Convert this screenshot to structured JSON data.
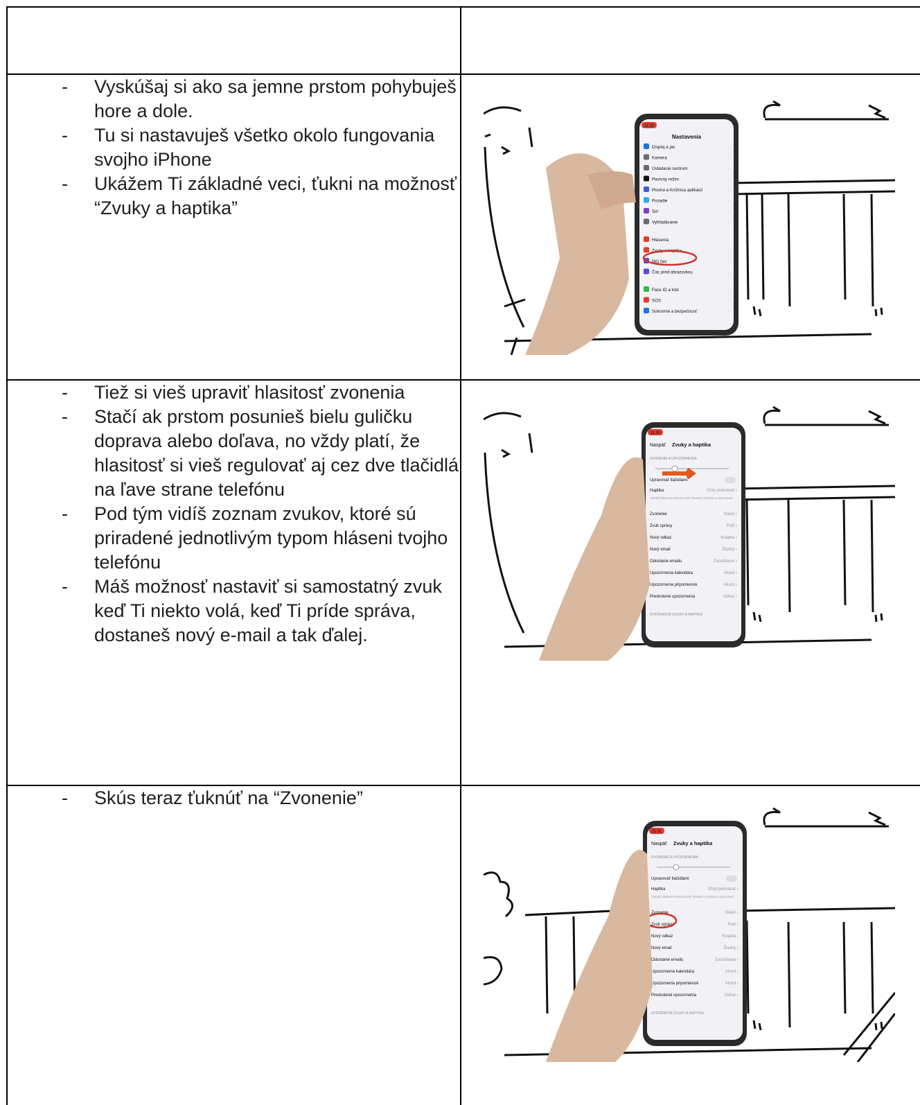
{
  "rows": [
    {
      "bullets": [
        "Vyskúšaj si ako sa jemne prstom pohybuješ hore a dole.",
        "Tu si nastavuješ všetko okolo fungovania svojho iPhone",
        "Ukážem Ti základné veci, ťukni na možnosť “Zvuky a haptika”"
      ],
      "phone": {
        "time": "11:30",
        "title": "Nastavenia",
        "items": [
          "Displej a jas",
          "Kamera",
          "Ovládacie centrum",
          "Pasívny režim",
          "Plocha a Knižnica aplikácií",
          "Pozadie",
          "Siri",
          "Vyhľadávanie",
          "Hlásenia",
          "Zvuky a haptika",
          "Môj čas",
          "Čas pred obrazovkou",
          "Face ID a kód",
          "SOS",
          "Súkromie a bezpečnosť"
        ]
      }
    },
    {
      "bullets": [
        "Tiež si vieš upraviť hlasitosť zvonenia",
        "Stačí ak prstom posunieš bielu guličku doprava alebo doľava, no vždy platí, že hlasitosť si vieš regulovať aj cez dve tlačidlá na ľave strane telefónu",
        "Pod tým vidíš zoznam zvukov, ktoré sú priradené jednotlivým typom hláseni tvojho telefónu",
        "Máš možnosť nastaviť si samostatný zvuk keď Ti niekto volá, keď Ti príde správa, dostaneš nový e-mail a tak ďalej."
      ],
      "phone": {
        "time": "11:30",
        "back": "Naspäť",
        "title": "Zvuky a haptika",
        "section": "ZVONENIE A UPOZORNENIA",
        "toggle": "Upravovať tlačidlami",
        "haptic": [
          "Haptika",
          "Vždy prehrávať"
        ],
        "note": "Tlačidlá hlasitosti nebudú meniť hlasitosť zvonenia a upozornení.",
        "sounds": [
          [
            "Zvonenie",
            "Klavír"
          ],
          [
            "Zvuk správy",
            "Pulz"
          ],
          [
            "Nový odkaz",
            "Kvapka"
          ],
          [
            "Nový email",
            "Žiadny"
          ],
          [
            "Odoslanie emailu",
            "Zasvištanie"
          ],
          [
            "Upozornenia kalendára",
            "Akord"
          ],
          [
            "Upozornenia pripomienok",
            "Akord"
          ],
          [
            "Predvolené upozornenia",
            "Odraz"
          ]
        ],
        "footer": "SYSTÉMOVÉ ZVUKY A HAPTIKA"
      }
    },
    {
      "bullets": [
        "Skús teraz ťuknúť na “Zvonenie”"
      ],
      "phone": {
        "time": "11:31",
        "back": "Naspäť",
        "title": "Zvuky a haptika",
        "section": "ZVONENIE A UPOZORNENIA",
        "toggle": "Upravovať tlačidlami",
        "haptic": [
          "Haptika",
          "Vždy prehrávať"
        ],
        "note": "Tlačidlá hlasitosti nebudú meniť hlasitosť zvonenia a upozornení.",
        "sounds": [
          [
            "Zvonenie",
            "Klavír"
          ],
          [
            "Zvuk správy",
            "Pulz"
          ],
          [
            "Nový odkaz",
            "Kvapka"
          ],
          [
            "Nový email",
            "Žiadny"
          ],
          [
            "Odoslanie emailu",
            "Zasvištanie"
          ],
          [
            "Upozornenia kalendára",
            "Akord"
          ],
          [
            "Upozornenia pripomienok",
            "Akord"
          ],
          [
            "Predvolené upozornenia",
            "Odraz"
          ]
        ],
        "footer": "SYSTÉMOVÉ ZVUKY A HAPTIKA"
      }
    }
  ]
}
